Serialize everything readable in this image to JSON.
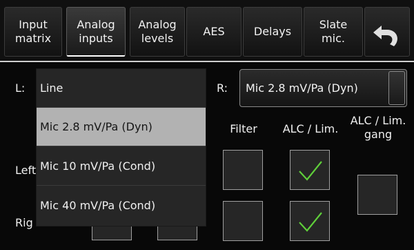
{
  "tabs": [
    {
      "label": "Input\nmatrix",
      "active": false
    },
    {
      "label": "Analog\ninputs",
      "active": true
    },
    {
      "label": "Analog\nlevels",
      "active": false
    },
    {
      "label": "AES",
      "active": false
    },
    {
      "label": "Delays",
      "active": false
    },
    {
      "label": "Slate\nmic.",
      "active": false
    }
  ],
  "back_icon": "undo-arrow-icon",
  "left_input": {
    "label": "L:"
  },
  "right_input": {
    "label": "R:",
    "value": "Mic 2.8 mV/Pa (Dyn)"
  },
  "columns": {
    "filter": "Filter",
    "alc_lim": "ALC / Lim.",
    "alc_lim_gang": "ALC / Lim.\ngang"
  },
  "rows": {
    "left": "Left",
    "right": "Rig"
  },
  "toggles": {
    "left_filter": false,
    "left_alc": true,
    "right_filter": false,
    "right_alc": true,
    "gang": false
  },
  "dropdown": {
    "options": [
      "Line",
      "Mic 2.8 mV/Pa (Dyn)",
      "Mic 10 mV/Pa (Cond)",
      "Mic 40 mV/Pa (Cond)"
    ],
    "selected": "Mic 2.8 mV/Pa (Dyn)"
  },
  "colors": {
    "check": "#5fcf3a",
    "selected_bg": "#b2b2b2",
    "background": "#080808"
  }
}
